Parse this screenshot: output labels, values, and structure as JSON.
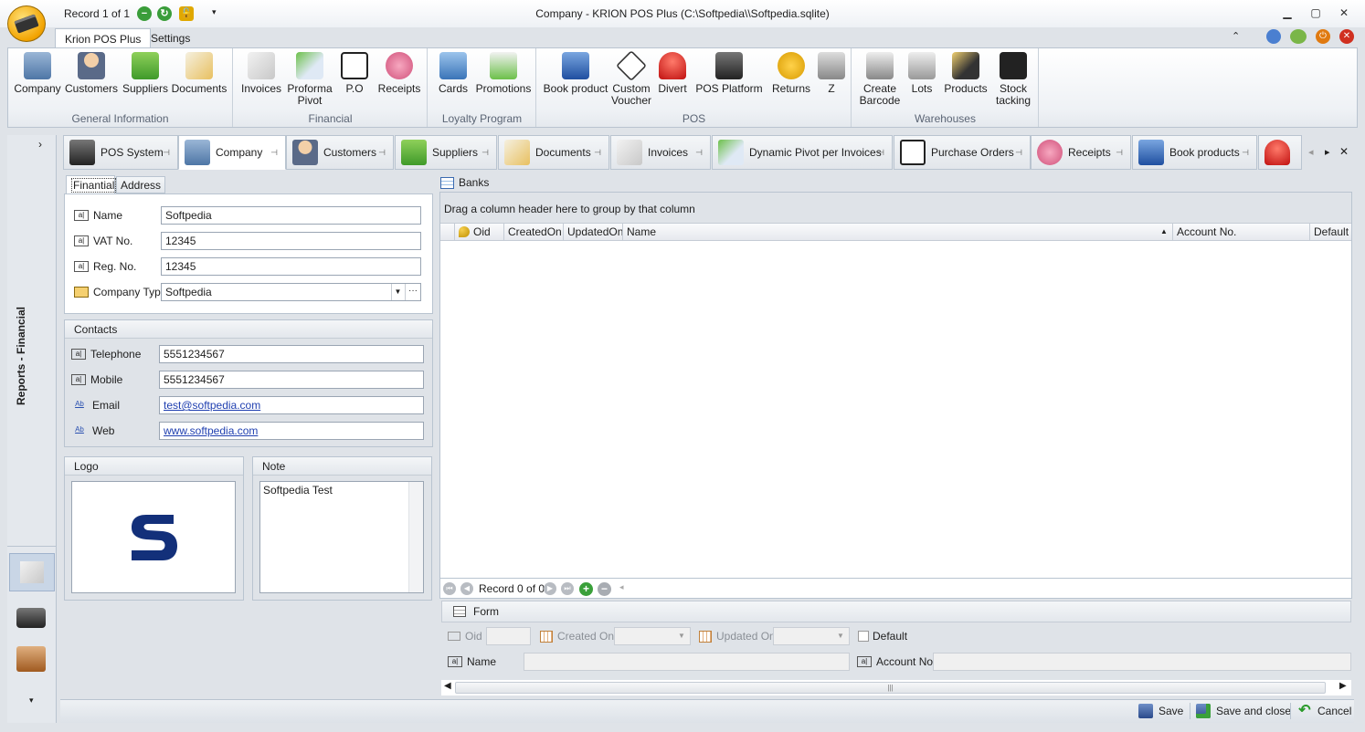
{
  "titlebar": {
    "record": "Record 1 of 1",
    "title": "Company - KRION POS Plus (C:\\Softpedia\\\\Softpedia.sqlite)"
  },
  "ribbon_tabs": [
    "Krion POS Plus",
    "Settings"
  ],
  "ribbon": {
    "groups": [
      {
        "label": "General Information",
        "buttons": [
          "Company",
          "Customers",
          "Suppliers",
          "Documents"
        ]
      },
      {
        "label": "Financial",
        "buttons": [
          "Invoices",
          "Proforma Pivot",
          "P.O",
          "Receipts"
        ]
      },
      {
        "label": "Loyalty Program",
        "buttons": [
          "Cards",
          "Promotions"
        ]
      },
      {
        "label": "POS",
        "buttons": [
          "Book product",
          "Custom Voucher",
          "Divert",
          "POS Platform",
          "Returns",
          "Z"
        ]
      },
      {
        "label": "Warehouses",
        "buttons": [
          "Create Barcode",
          "Lots",
          "Products",
          "Stock tacking"
        ]
      }
    ]
  },
  "sidebar": {
    "label": "Reports - Financial"
  },
  "doc_tabs": [
    "POS System",
    "Company",
    "Customers",
    "Suppliers",
    "Documents",
    "Invoices",
    "Dynamic Pivot per Invoices",
    "Purchase Orders",
    "Receipts",
    "Book products"
  ],
  "form": {
    "tabs": [
      "Finantial",
      "Address"
    ],
    "name_label": "Name",
    "name": "Softpedia",
    "vat_label": "VAT No.",
    "vat": "12345",
    "reg_label": "Reg. No.",
    "reg": "12345",
    "type_label": "Company Type",
    "type": "Softpedia",
    "contacts_title": "Contacts",
    "tel_label": "Telephone",
    "tel": "5551234567",
    "mobile_label": "Mobile",
    "mobile": "5551234567",
    "email_label": "Email",
    "email": "test@softpedia.com",
    "web_label": "Web",
    "web": "www.softpedia.com",
    "logo_title": "Logo",
    "note_title": "Note",
    "note": "Softpedia Test"
  },
  "banks": {
    "title": "Banks",
    "group_hint": "Drag a column header here to group by that column",
    "columns": [
      "Oid",
      "CreatedOn",
      "UpdatedOn",
      "Name",
      "Account No.",
      "Default"
    ],
    "nav_record": "Record 0 of 0",
    "form_title": "Form",
    "oid_label": "Oid",
    "created_label": "Created On",
    "updated_label": "Updated On",
    "default_label": "Default",
    "name_label": "Name",
    "account_label": "Account No."
  },
  "actions": {
    "save": "Save",
    "save_close": "Save and close",
    "cancel": "Cancel"
  }
}
